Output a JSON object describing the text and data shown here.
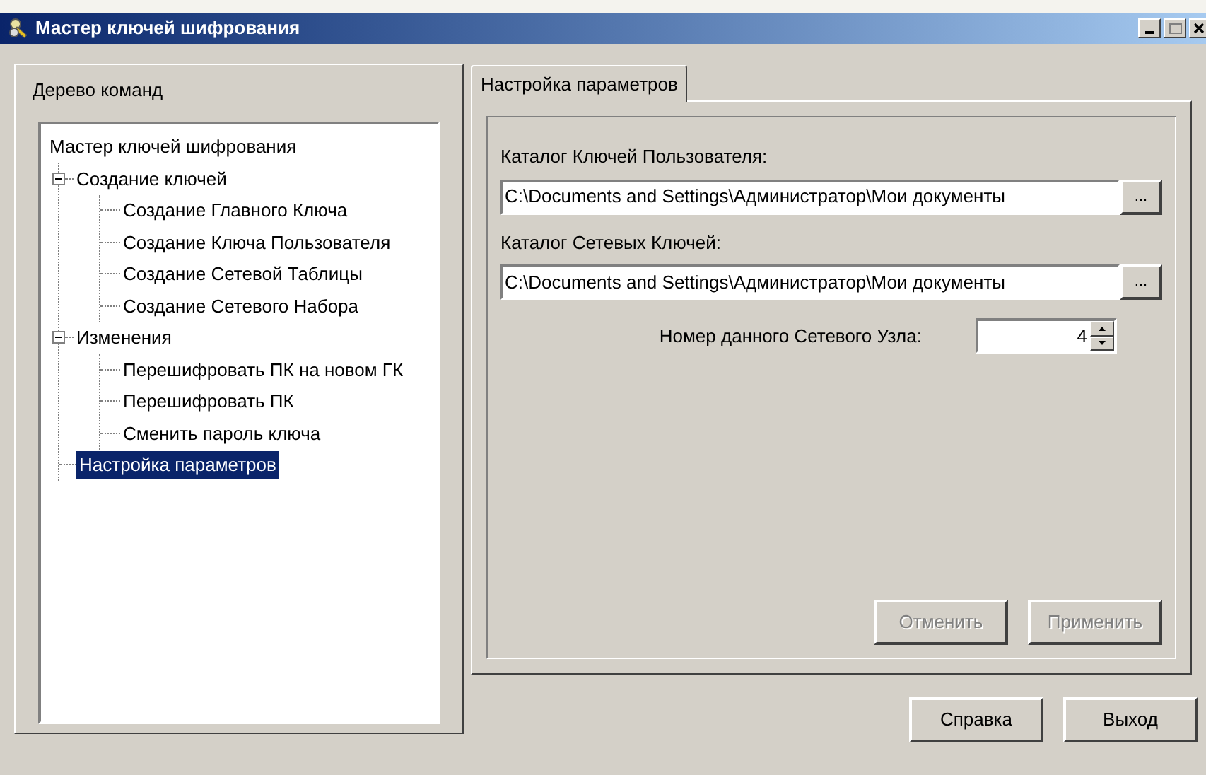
{
  "window": {
    "title": "Мастер ключей шифрования"
  },
  "tree_panel": {
    "title": "Дерево команд",
    "tree": [
      {
        "label": "Мастер ключей шифрования",
        "selected": false,
        "children": [
          {
            "label": "Создание ключей",
            "expanded": true,
            "selected": false,
            "children": [
              {
                "label": "Создание Главного Ключа",
                "selected": false
              },
              {
                "label": "Создание Ключа Пользователя",
                "selected": false
              },
              {
                "label": "Создание Сетевой Таблицы",
                "selected": false
              },
              {
                "label": "Создание Сетевого Набора",
                "selected": false
              }
            ]
          },
          {
            "label": "Изменения",
            "expanded": true,
            "selected": false,
            "children": [
              {
                "label": "Перешифровать ПК на новом ГК",
                "selected": false
              },
              {
                "label": "Перешифровать ПК",
                "selected": false
              },
              {
                "label": "Сменить пароль ключа",
                "selected": false
              }
            ]
          },
          {
            "label": "Настройка параметров",
            "selected": true
          }
        ]
      }
    ]
  },
  "tabs": [
    {
      "label": "Настройка параметров",
      "selected": true
    }
  ],
  "settings": {
    "paths": [
      {
        "label": "Каталог Ключей Пользователя:",
        "value": "C:\\Documents and Settings\\Администратор\\Мои документы",
        "browse": "..."
      },
      {
        "label": "Каталог Сетевых Ключей:",
        "value": "C:\\Documents and Settings\\Администратор\\Мои документы",
        "browse": "..."
      }
    ],
    "node_number": {
      "label": "Номер данного Сетевого Узла:",
      "value": "4"
    },
    "buttons": [
      {
        "label": "Отменить",
        "disabled": true
      },
      {
        "label": "Применить",
        "disabled": true
      }
    ]
  },
  "buttons": [
    {
      "label": "Справка",
      "disabled": false
    },
    {
      "label": "Выход",
      "disabled": false
    }
  ]
}
